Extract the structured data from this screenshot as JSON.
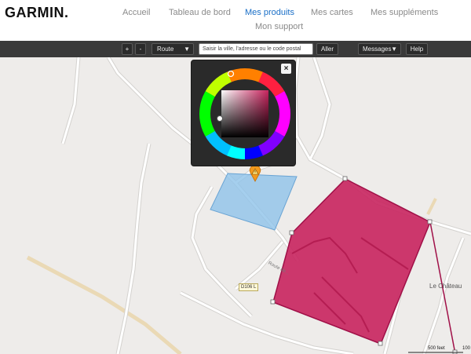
{
  "header": {
    "logo": "GARMIN.",
    "nav": [
      {
        "label": "Accueil",
        "active": false
      },
      {
        "label": "Tableau de bord",
        "active": false
      },
      {
        "label": "Mes produits",
        "active": true
      },
      {
        "label": "Mes cartes",
        "active": false
      },
      {
        "label": "Mes suppléments",
        "active": false
      },
      {
        "label": "Mon support",
        "active": false
      }
    ]
  },
  "toolbar": {
    "zoom_in": "+",
    "zoom_out": "-",
    "route_select": "Route",
    "search_placeholder": "Saisir la ville, l'adresse ou le code postal",
    "go_button": "Aller",
    "messages_select": "Messages",
    "help_button": "Help"
  },
  "map": {
    "place_label": "Le Château",
    "road_label": "D106 L",
    "street_label": "Route de...",
    "scale_feet": "500 feet",
    "scale_partial": "100",
    "picker_close": "×",
    "colors": {
      "polygon_fill": "#c8245e",
      "polygon_stroke": "#a01048",
      "blue_fill": "#8ec3ea",
      "road": "#ffffff",
      "background": "#eeecea"
    }
  }
}
